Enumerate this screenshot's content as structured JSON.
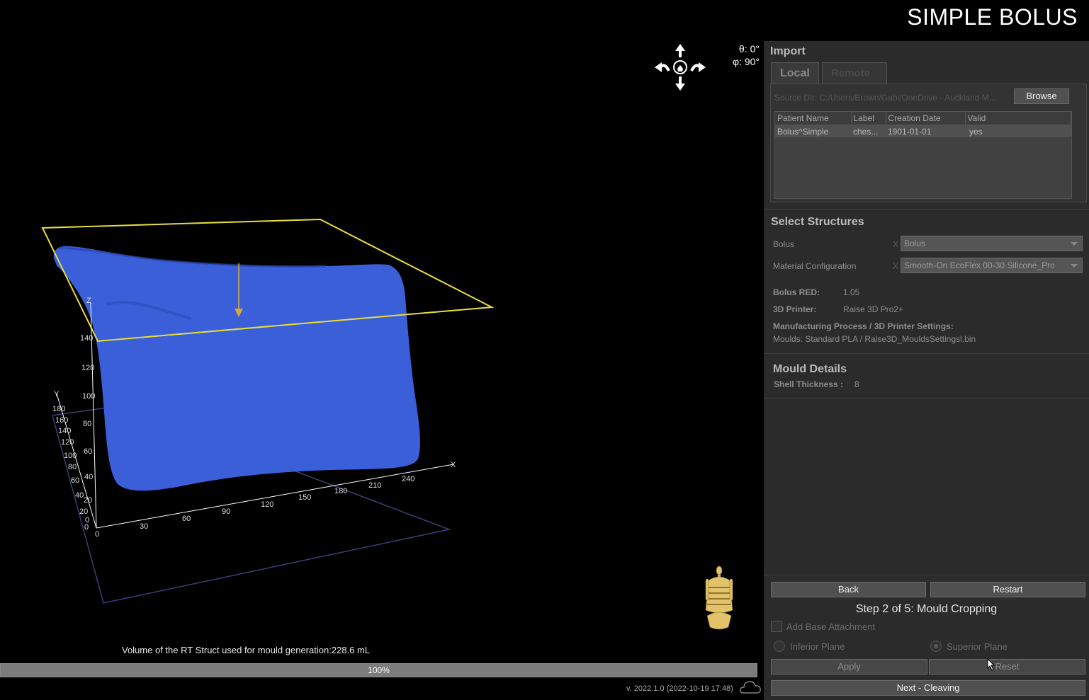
{
  "app": {
    "title": "SIMPLE BOLUS"
  },
  "viewport": {
    "theta": "θ: 0°",
    "phi": "φ: 90°",
    "volume_text": "Volume of the RT Struct used for mould generation:228.6 mL",
    "progress": {
      "label": "100%",
      "value": 1.0
    },
    "version": "v. 2022.1.0 (2022-10-19 17:48)",
    "axes": {
      "x_label": "X",
      "y_label": "Y",
      "z_label": "Z",
      "x_ticks": [
        "0",
        "30",
        "60",
        "90",
        "120",
        "150",
        "180",
        "210",
        "240"
      ],
      "y_ticks": [
        "0",
        "20",
        "40",
        "60",
        "80",
        "100",
        "120",
        "140",
        "160",
        "180"
      ],
      "z_ticks": [
        "0",
        "20",
        "40",
        "60",
        "80",
        "100",
        "120",
        "140"
      ]
    }
  },
  "panel": {
    "import": {
      "title": "Import",
      "tabs": [
        {
          "label": "Local"
        },
        {
          "label": "Remote"
        }
      ],
      "source": "Source Dir: C:/Users/Brown/Gabi/OneDrive - Auckland M...",
      "browse_label": "Browse",
      "table": {
        "headers": [
          "Patient Name",
          "Label",
          "Creation Date",
          "Valid"
        ],
        "rows": [
          [
            "Bolus^Simple",
            "ches...",
            "1901-01-01",
            "yes"
          ]
        ]
      }
    },
    "structures": {
      "title": "Select Structures",
      "bolus_label": "Bolus",
      "bolus_value": "Bolus",
      "material_label": "Material Configuration",
      "material_value": "Smooth-On EcoFlex 00-30 Silicone_Pro",
      "x_mark": "X",
      "red_label": "Bolus RED:",
      "red_value": "1.05",
      "printer_label": "3D Printer:",
      "printer_value": "Raise 3D Pro2+",
      "process_label": "Manufacturing Process / 3D Printer Settings:",
      "process_value": "Moulds: Standard PLA / Raise3D_MouldsSettingsl.bin"
    },
    "mould": {
      "title": "Mould Details",
      "shell_label": "Shell Thickness :",
      "shell_value": "8"
    },
    "footer": {
      "back_label": "Back",
      "restart_label": "Restart",
      "step_text": "Step 2 of 5: Mould Cropping",
      "base_attachment_label": "Add Base Attachment",
      "inferior_label": "Inferior Plane",
      "superior_label": "Superior Plane",
      "apply_label": "Apply",
      "reset_label": "Reset",
      "next_label": "Next - Cleaving"
    }
  },
  "colors": {
    "bolus": "#3a5fd8",
    "crop_plane": "#e8df3c",
    "bounding_box": "#3a3f7a",
    "panel_bg": "#2b2b2b"
  }
}
